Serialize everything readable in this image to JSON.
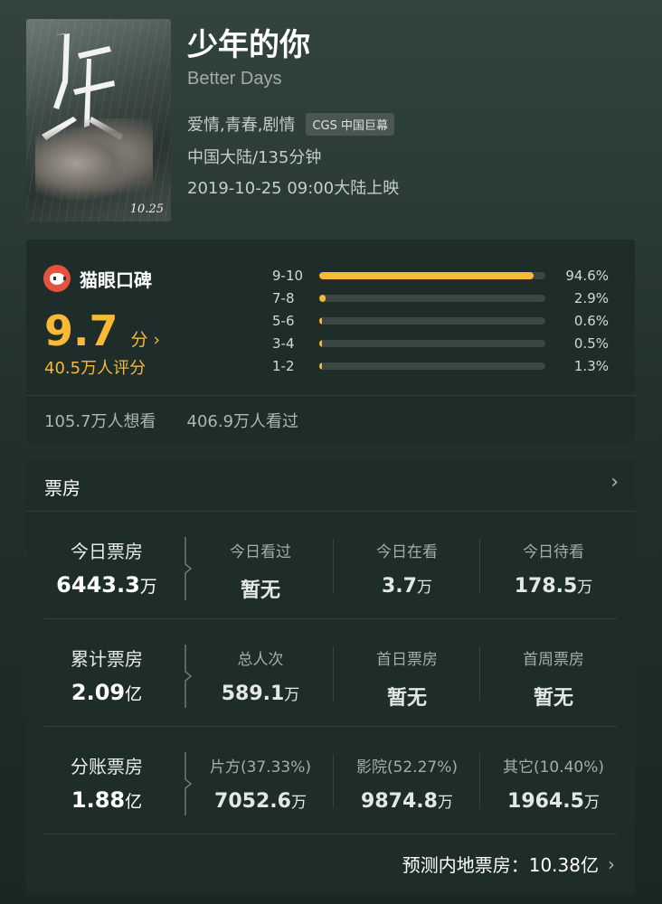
{
  "movie": {
    "title": "少年的你",
    "title_en": "Better Days",
    "genres": "爱情,青春,剧情",
    "format_tag": "CGS 中国巨幕",
    "region_duration": "中国大陆/135分钟",
    "release": "2019-10-25 09:00大陆上映",
    "poster_date": "10.25"
  },
  "rating": {
    "brand": "猫眼口碑",
    "score": "9.7",
    "score_unit": "分",
    "score_arrow": "›",
    "raters": "40.5万人评分",
    "distribution": [
      {
        "range": "9-10",
        "pct": "94.6%",
        "value": 94.6
      },
      {
        "range": "7-8",
        "pct": "2.9%",
        "value": 2.9
      },
      {
        "range": "5-6",
        "pct": "0.6%",
        "value": 0.6
      },
      {
        "range": "3-4",
        "pct": "0.5%",
        "value": 0.5
      },
      {
        "range": "1-2",
        "pct": "1.3%",
        "value": 1.3
      }
    ],
    "want_to_see": "105.7万人想看",
    "watched": "406.9万人看过",
    "accent_color": "#f7b936"
  },
  "boxoffice": {
    "header": "票房",
    "chevron": "›",
    "rows": [
      {
        "main_label": "今日票房",
        "main_value": "6443.3",
        "main_unit": "万",
        "subs": [
          {
            "label": "今日看过",
            "value": "暂无",
            "unit": ""
          },
          {
            "label": "今日在看",
            "value": "3.7",
            "unit": "万"
          },
          {
            "label": "今日待看",
            "value": "178.5",
            "unit": "万"
          }
        ]
      },
      {
        "main_label": "累计票房",
        "main_value": "2.09",
        "main_unit": "亿",
        "subs": [
          {
            "label": "总人次",
            "value": "589.1",
            "unit": "万"
          },
          {
            "label": "首日票房",
            "value": "暂无",
            "unit": ""
          },
          {
            "label": "首周票房",
            "value": "暂无",
            "unit": ""
          }
        ]
      },
      {
        "main_label": "分账票房",
        "main_value": "1.88",
        "main_unit": "亿",
        "subs": [
          {
            "label": "片方(37.33%)",
            "value": "7052.6",
            "unit": "万"
          },
          {
            "label": "影院(52.27%)",
            "value": "9874.8",
            "unit": "万"
          },
          {
            "label": "其它(10.40%)",
            "value": "1964.5",
            "unit": "万"
          }
        ]
      }
    ],
    "forecast": "预测内地票房：10.38亿",
    "forecast_chevron": "›"
  }
}
